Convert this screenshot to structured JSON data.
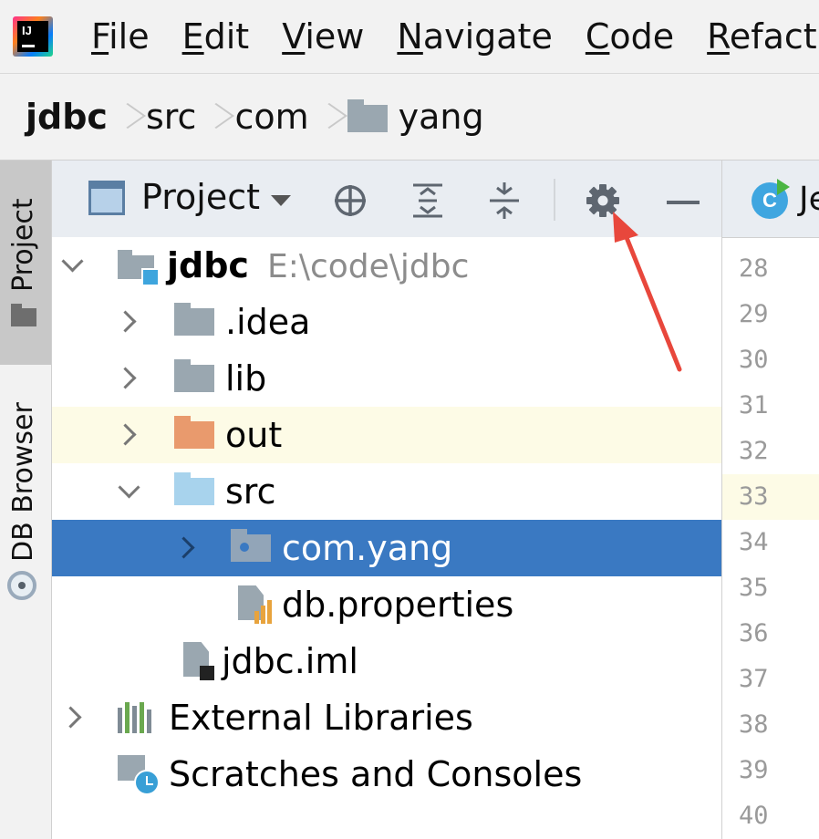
{
  "menubar": {
    "items": [
      {
        "mnemonic": "F",
        "rest": "ile"
      },
      {
        "mnemonic": "E",
        "rest": "dit"
      },
      {
        "mnemonic": "V",
        "rest": "iew"
      },
      {
        "mnemonic": "N",
        "rest": "avigate"
      },
      {
        "mnemonic": "C",
        "rest": "ode"
      },
      {
        "mnemonic": "R",
        "rest": "efact"
      }
    ]
  },
  "breadcrumb": {
    "items": [
      "jdbc",
      "src",
      "com",
      "yang"
    ]
  },
  "toolstrip": {
    "project_label": "Project",
    "db_browser_label": "DB Browser"
  },
  "project_panel": {
    "view_label": "Project",
    "tree": [
      {
        "label": "jdbc",
        "path": "E:\\code\\jdbc"
      },
      {
        "label": ".idea"
      },
      {
        "label": "lib"
      },
      {
        "label": "out"
      },
      {
        "label": "src"
      },
      {
        "label": "com.yang"
      },
      {
        "label": "db.properties"
      },
      {
        "label": "jdbc.iml"
      },
      {
        "label": "External Libraries"
      },
      {
        "label": "Scratches and Consoles"
      }
    ]
  },
  "editor": {
    "tab_label": "Je",
    "class_icon_letter": "C",
    "line_numbers": [
      "28",
      "29",
      "30",
      "31",
      "32",
      "33",
      "34",
      "35",
      "36",
      "37",
      "38",
      "39",
      "40"
    ],
    "current_line": "33"
  },
  "colors": {
    "selection": "#3a79c2",
    "highlight_row": "#fdfbe6",
    "annotation_arrow": "#e8473c"
  }
}
